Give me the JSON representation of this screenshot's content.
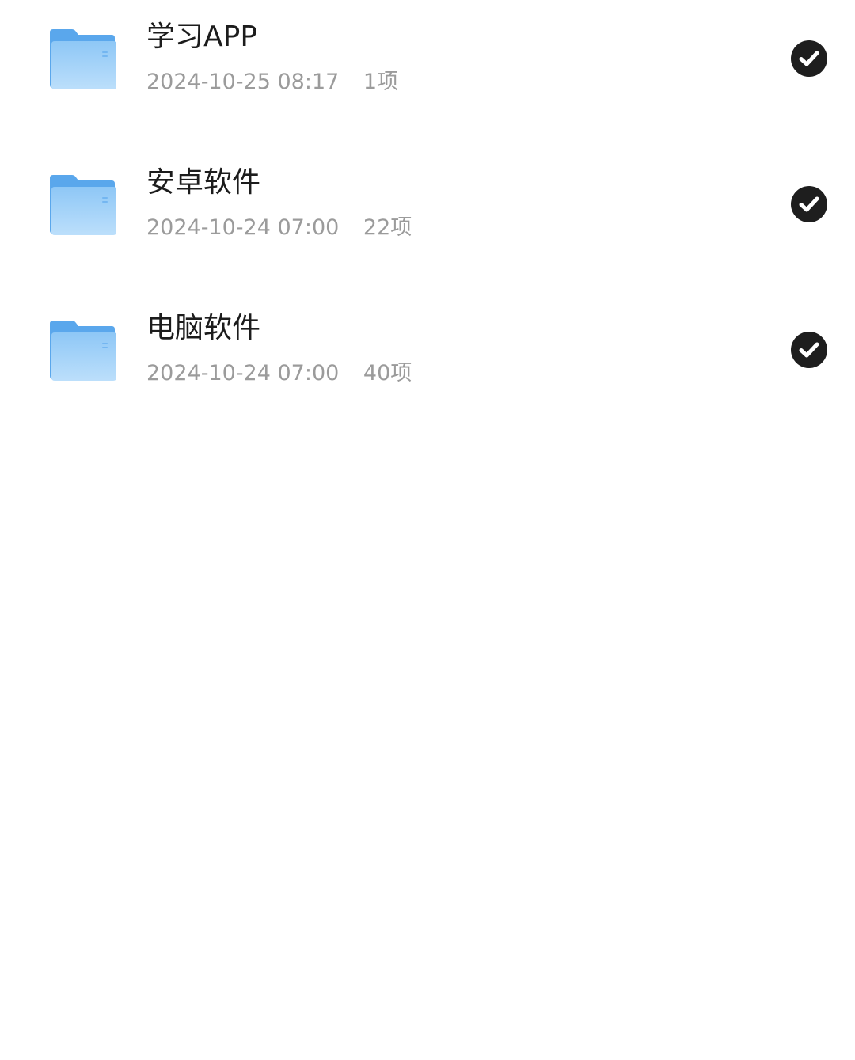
{
  "folders": [
    {
      "name": "学习APP",
      "date": "2024-10-25 08:17",
      "count": "1项",
      "selected": true,
      "icon": "folder-icon"
    },
    {
      "name": "安卓软件",
      "date": "2024-10-24 07:00",
      "count": "22项",
      "selected": true,
      "icon": "folder-icon"
    },
    {
      "name": "电脑软件",
      "date": "2024-10-24 07:00",
      "count": "40项",
      "selected": true,
      "icon": "folder-icon"
    }
  ],
  "colors": {
    "folder_back": "#5aa7ec",
    "folder_front_top": "#8ec7f6",
    "folder_front_bottom": "#b8dcfa",
    "check_fill": "#1e1e1e",
    "meta_text": "#9b9b9b",
    "name_text": "#1c1c1c"
  }
}
